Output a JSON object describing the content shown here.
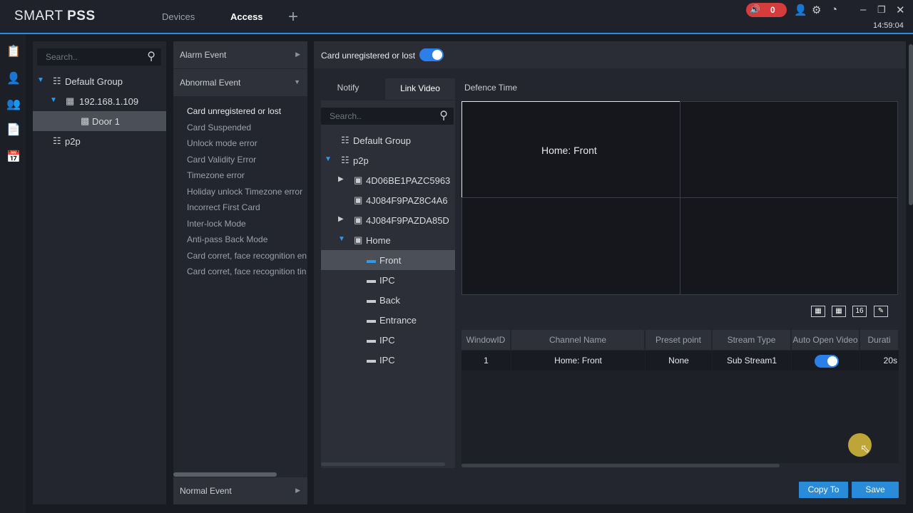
{
  "titlebar": {
    "app_name": "SMART",
    "app_name_bold": "PSS",
    "tabs": [
      "Devices",
      "Access"
    ],
    "new_tab": "+",
    "alarm_count": "0",
    "clock": "14:59:04"
  },
  "device_panel": {
    "search_placeholder": "Search..",
    "tree": {
      "group": "Default Group",
      "device": "192.168.1.109",
      "door": "Door 1",
      "p2p": "p2p"
    }
  },
  "events": {
    "alarm_event": "Alarm Event",
    "abnormal_event": "Abnormal Event",
    "items": [
      "Card unregistered or lost",
      "Card Suspended",
      "Unlock mode error",
      "Card Validity Error",
      "Timezone error",
      "Holiday unlock Timezone error",
      "Incorrect First Card",
      "Inter-lock Mode",
      "Anti-pass Back Mode",
      "Card corret, face recognition en",
      "Card corret, face recognition tin"
    ],
    "normal_event": "Normal Event"
  },
  "config": {
    "event_name": "Card unregistered or lost",
    "enabled": true,
    "tabs": [
      "Notify",
      "Link Video",
      "Defence Time"
    ],
    "active_tab": "Link Video"
  },
  "channel_tree": {
    "search_placeholder": "Search..",
    "default_group": "Default Group",
    "p2p": "p2p",
    "devices": [
      "4D06BE1PAZC5963",
      "4J084F9PAZ8C4A6",
      "4J084F9PAZDA85D"
    ],
    "home": "Home",
    "channels": [
      "Front",
      "IPC",
      "Back",
      "Entrance",
      "IPC",
      "IPC"
    ]
  },
  "video_grid": {
    "active_cell_label": "Home: Front"
  },
  "layout_buttons": {
    "sixteen": "16"
  },
  "table": {
    "headers": [
      "WindowID",
      "Channel Name",
      "Preset point",
      "Stream Type",
      "Auto Open Video",
      "Durati"
    ],
    "rows": [
      {
        "window_id": "1",
        "channel_name": "Home: Front",
        "preset": "None",
        "stream": "Sub Stream1",
        "auto_open": true,
        "duration": "20s"
      }
    ]
  },
  "buttons": {
    "copy_to": "Copy To",
    "save": "Save"
  },
  "colors": {
    "accent": "#2a8bd8",
    "alarm": "#d63c3c",
    "background": "#181b22"
  }
}
